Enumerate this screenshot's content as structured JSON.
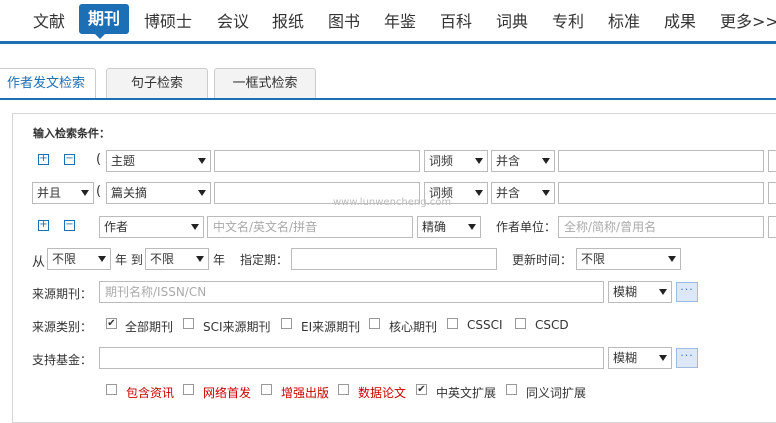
{
  "nav": {
    "items": [
      "文献",
      "期刊",
      "博硕士",
      "会议",
      "报纸",
      "图书",
      "年鉴",
      "百科",
      "词典",
      "专利",
      "标准",
      "成果",
      "更多>>"
    ],
    "active_index": 1,
    "accent_color": "#1c6fb5"
  },
  "tabs": [
    "作者发文检索",
    "句子检索",
    "一框式检索"
  ],
  "form": {
    "section_title": "输入检索条件：",
    "row1": {
      "paren": "(",
      "field": "主题",
      "freq": "词频",
      "logic": "并含"
    },
    "row2": {
      "op": "并且",
      "paren": "(",
      "field": "篇关摘",
      "freq": "词频",
      "logic": "并含"
    },
    "row3": {
      "field": "作者",
      "input_placeholder": "中文名/英文名/拼音",
      "match": "精确",
      "unit_label": "作者单位：",
      "unit_placeholder": "全称/简称/曾用名"
    },
    "date_row": {
      "from_label": "从",
      "from_value": "不限",
      "year_to_label": "年 到",
      "to_value": "不限",
      "year_label": "年",
      "specified_label": "指定期：",
      "update_label": "更新时间：",
      "update_value": "不限"
    },
    "source_journal": {
      "label": "来源期刊：",
      "placeholder": "期刊名称/ISSN/CN",
      "mode": "模糊"
    },
    "source_type": {
      "label": "来源类别：",
      "options": [
        {
          "text": "全部期刊",
          "checked": true
        },
        {
          "text": "SCI来源期刊",
          "checked": false
        },
        {
          "text": "EI来源期刊",
          "checked": false
        },
        {
          "text": "核心期刊",
          "checked": false
        },
        {
          "text": "CSSCI",
          "checked": false
        },
        {
          "text": "CSCD",
          "checked": false
        }
      ]
    },
    "fund": {
      "label": "支持基金：",
      "mode": "模糊"
    },
    "extras": [
      {
        "text": "包含资讯",
        "checked": false,
        "red": true
      },
      {
        "text": "网络首发",
        "checked": false,
        "red": true
      },
      {
        "text": "增强出版",
        "checked": false,
        "red": true
      },
      {
        "text": "数据论文",
        "checked": false,
        "red": true
      },
      {
        "text": "中英文扩展",
        "checked": true,
        "red": false
      },
      {
        "text": "同义词扩展",
        "checked": false,
        "red": false
      }
    ]
  },
  "watermark": "www.lunwencheng.com",
  "icons": {
    "plus": "+",
    "minus": "−",
    "more": "···",
    "check": "✔"
  }
}
